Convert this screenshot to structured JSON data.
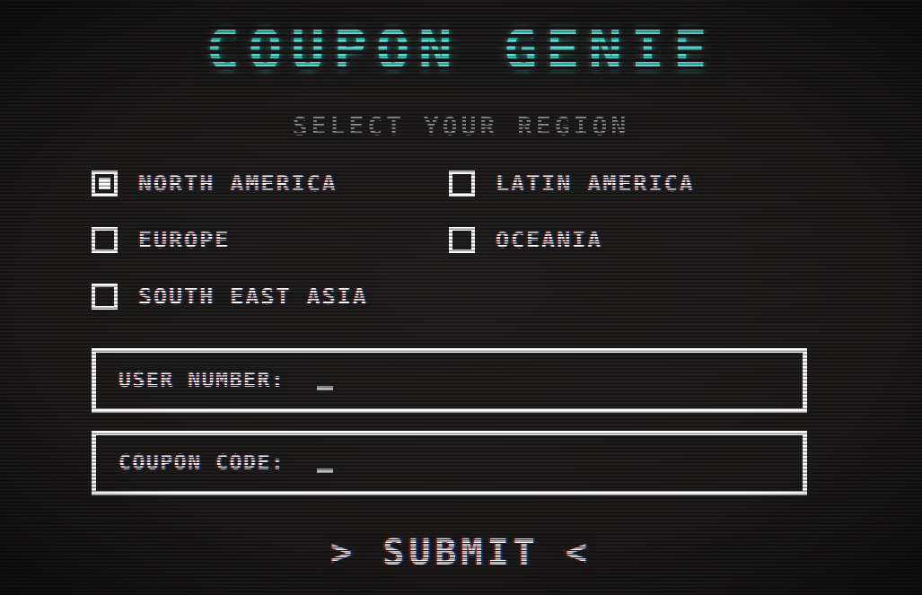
{
  "screen": {
    "title": "COUPON GENIE",
    "subtitle": "SELECT YOUR REGION",
    "accent_color": "#57ddd3",
    "text_color": "#ffffff",
    "subtitle_color": "#b6b6b6",
    "background_color": "#1f1c1c"
  },
  "regions": {
    "options": [
      {
        "label": "NORTH AMERICA",
        "checked": true
      },
      {
        "label": "LATIN AMERICA",
        "checked": false
      },
      {
        "label": "EUROPE",
        "checked": false
      },
      {
        "label": "OCEANIA",
        "checked": false
      },
      {
        "label": "SOUTH EAST ASIA",
        "checked": false
      }
    ]
  },
  "fields": {
    "user_number": {
      "label": "USER NUMBER:",
      "value": "",
      "cursor": "_"
    },
    "coupon_code": {
      "label": "COUPON CODE:",
      "value": "",
      "cursor": "_"
    }
  },
  "actions": {
    "submit_label": "> SUBMIT <"
  }
}
